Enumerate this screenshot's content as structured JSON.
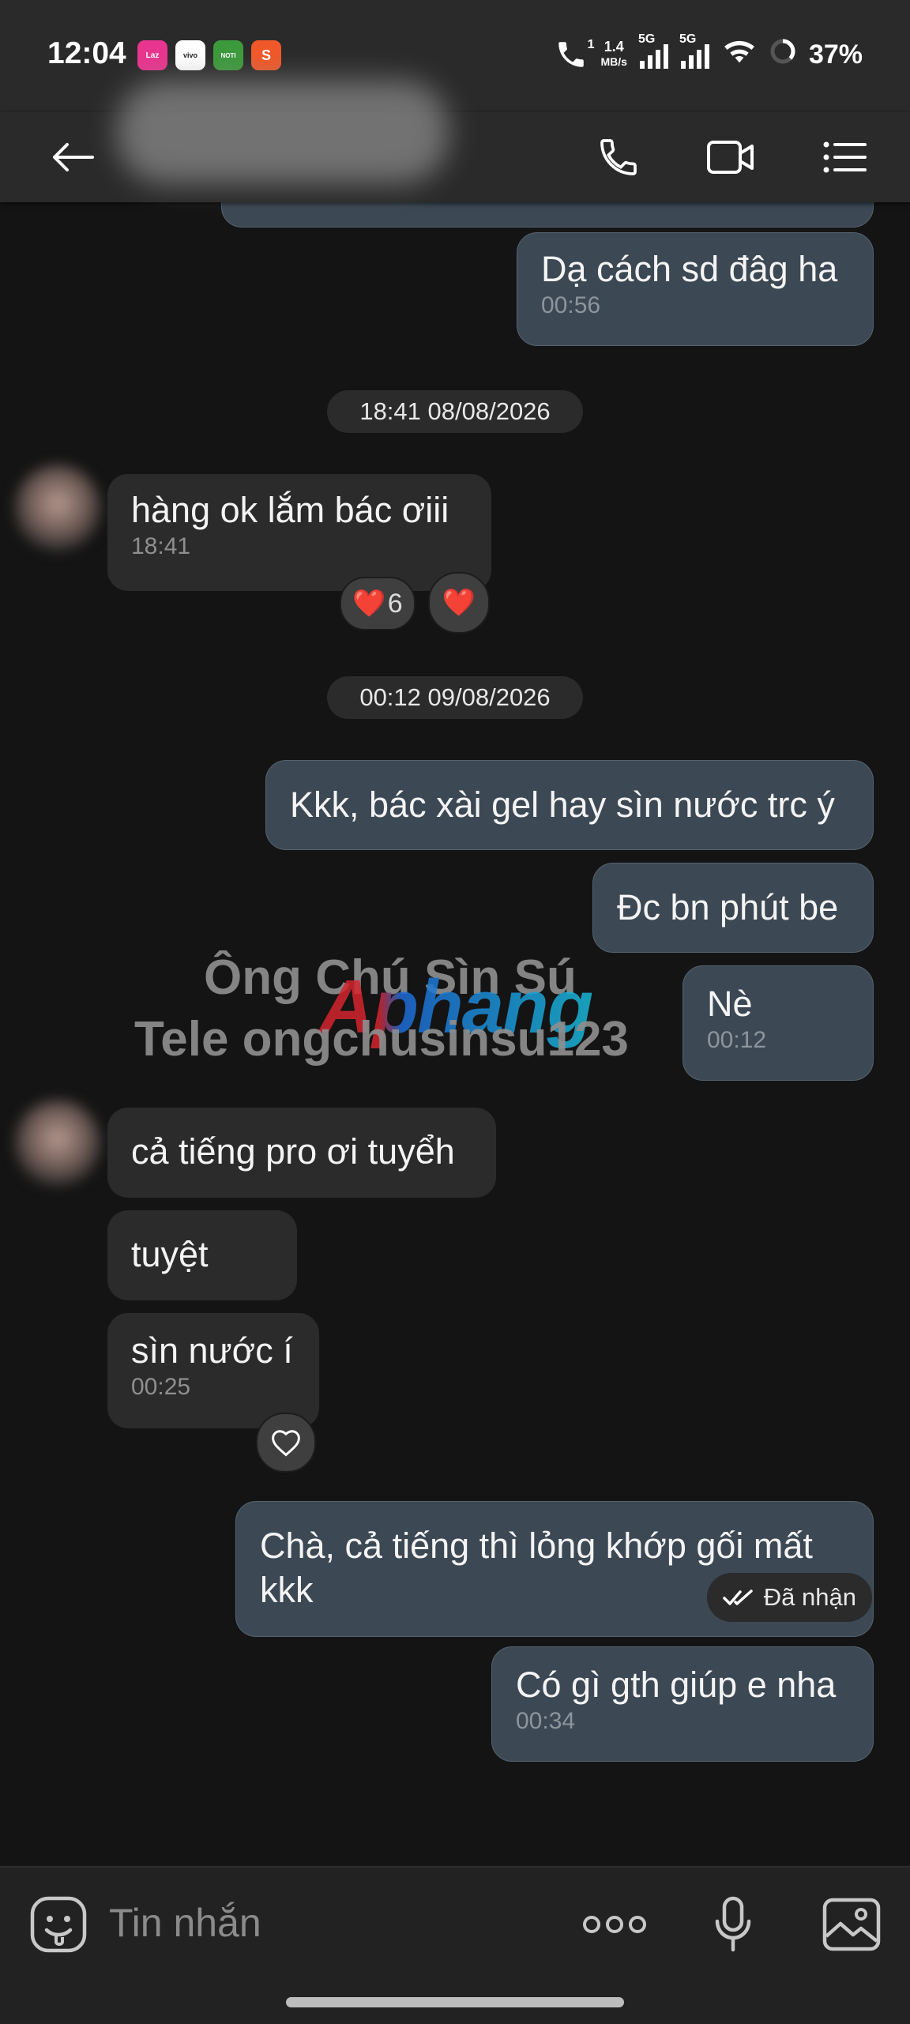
{
  "status_bar": {
    "time": "12:04",
    "app_icons": [
      {
        "name": "lazada-app-icon",
        "label": "Laz",
        "color": "#e8358f"
      },
      {
        "name": "vivo-app-icon",
        "label": "vivo",
        "color": "#ffffff"
      },
      {
        "name": "noti-app-icon",
        "label": "NOTI",
        "color": "#3c9a3c"
      },
      {
        "name": "shopee-app-icon",
        "label": "S",
        "color": "#f0582a"
      }
    ],
    "call_indicator": "1",
    "net_speed_value": "1.4",
    "net_speed_unit": "MB/s",
    "sim1": "5G",
    "sim2": "5G",
    "battery": "37%"
  },
  "header": {
    "back_icon": "arrow-left-icon",
    "call_icon": "phone-icon",
    "video_icon": "video-camera-icon",
    "menu_icon": "list-menu-icon"
  },
  "messages": {
    "m1": {
      "text": "Dạ cách sd đâg ha",
      "time": "00:56"
    },
    "date1": "18:41 08/08/2026",
    "m2": {
      "text": "hàng ok lắm bác ơiii",
      "time": "18:41",
      "reaction_count": "6"
    },
    "date2": "00:12 09/08/2026",
    "m3": {
      "text": "Kkk, bác xài gel hay sìn nước trc ý"
    },
    "m4": {
      "text": "Đc bn phút be"
    },
    "m5": {
      "text": "Nè",
      "time": "00:12"
    },
    "m6": {
      "text": "cả tiếng pro ơi tuyểh"
    },
    "m7": {
      "text": "tuyệt"
    },
    "m8": {
      "text": "sìn nước í",
      "time": "00:25"
    },
    "m9": {
      "text": "Chà, cả tiếng thì lỏng khớp gối mất kkk"
    },
    "m10": {
      "text": "Có gì gth giúp e nha",
      "time": "00:34"
    },
    "receipt": "Đã nhận"
  },
  "watermark": {
    "line1": "Ông Chú Sìn Sú",
    "line2": "Tele ongchusinsu123",
    "logo": "Aphang"
  },
  "input": {
    "placeholder": "Tin nhắn",
    "sticker_icon": "sticker-face-icon",
    "more_icon": "more-dots-icon",
    "mic_icon": "microphone-icon",
    "image_icon": "image-gallery-icon"
  }
}
